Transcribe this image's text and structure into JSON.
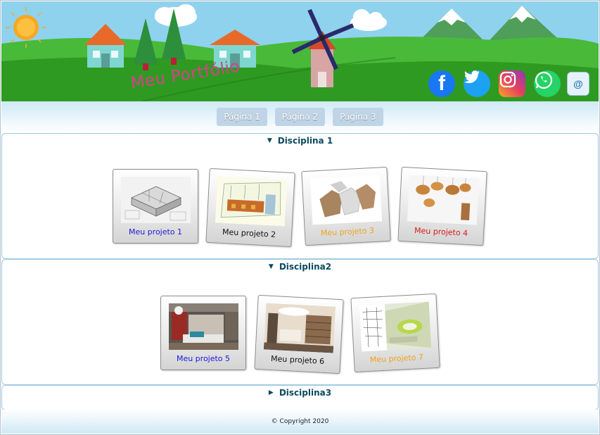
{
  "header": {
    "title": "Meu Portfólio",
    "social": [
      {
        "name": "facebook",
        "icon": "facebook-icon",
        "glyph": "f"
      },
      {
        "name": "twitter",
        "icon": "twitter-icon",
        "glyph": ""
      },
      {
        "name": "instagram",
        "icon": "instagram-icon",
        "glyph": ""
      },
      {
        "name": "whatsapp",
        "icon": "whatsapp-icon",
        "glyph": ""
      },
      {
        "name": "email",
        "icon": "email-icon",
        "glyph": "@"
      }
    ]
  },
  "nav": {
    "items": [
      "Página 1",
      "Página 2",
      "Página 3"
    ]
  },
  "sections": [
    {
      "title": "Disciplina 1",
      "expanded": true,
      "projects": [
        {
          "label": "Meu projeto 1",
          "color": "#1a1ad8"
        },
        {
          "label": "Meu projeto 2",
          "color": "#111111"
        },
        {
          "label": "Meu projeto 3",
          "color": "#f0a21a"
        },
        {
          "label": "Meu projeto 4",
          "color": "#d81a1a"
        }
      ]
    },
    {
      "title": "Disciplina2",
      "expanded": true,
      "projects": [
        {
          "label": "Meu projeto 5",
          "color": "#1a1ad8"
        },
        {
          "label": "Meu projeto 6",
          "color": "#111111"
        },
        {
          "label": "Meu projeto 7",
          "color": "#f0a21a"
        }
      ]
    },
    {
      "title": "Disciplina3",
      "expanded": false,
      "projects": []
    }
  ],
  "footer": {
    "copyright": "© Copyright 2020"
  }
}
